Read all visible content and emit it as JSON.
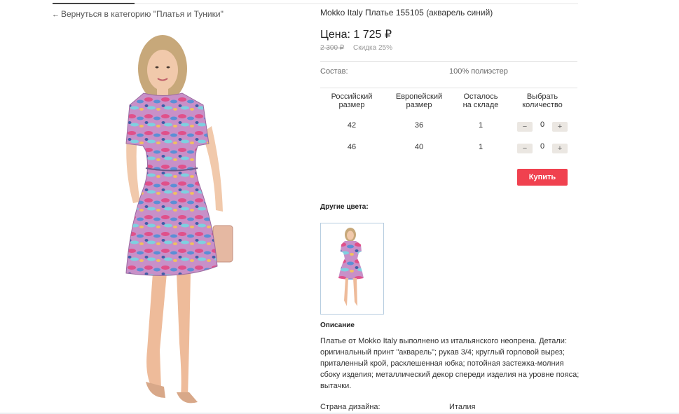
{
  "nav": {
    "back_label": "Вернуться в категорию \"Платья и Туники\""
  },
  "product": {
    "title": "Mokko Italy Платье 155105 (акварель синий)",
    "price": "Цена: 1 725 ₽",
    "old_price": "2 300 ₽",
    "discount": "Скидка 25%",
    "composition_label": "Состав:",
    "composition_value": "100% полиэстер"
  },
  "sizes": {
    "headers": [
      "Российский\nразмер",
      "Европейский\nразмер",
      "Осталось\nна складе",
      "Выбрать\nколичество"
    ],
    "rows": [
      {
        "ru": "42",
        "eu": "36",
        "stock": "1",
        "qty": "0"
      },
      {
        "ru": "46",
        "eu": "40",
        "stock": "1",
        "qty": "0"
      }
    ],
    "minus": "−",
    "plus": "+"
  },
  "buy_label": "Купить",
  "other_colors_label": "Другие цвета:",
  "description": {
    "heading": "Описание",
    "text": "Платье от Mokko Italy выполнено из итальянского неопрена. Детали: оригинальный принт \"акварель\"; рукав 3/4; круглый горловой вырез; приталенный крой, расклешенная юбка; потойная застежка-молния сбоку изделия; металлический декор спереди изделия на уровне пояса; вытачки."
  },
  "country": {
    "label": "Страна дизайна:",
    "value": "Италия"
  },
  "colors": {
    "buy": "#f0414f",
    "qty_btn": "#ebe7e2",
    "thumb_border": "#b7cde0"
  }
}
